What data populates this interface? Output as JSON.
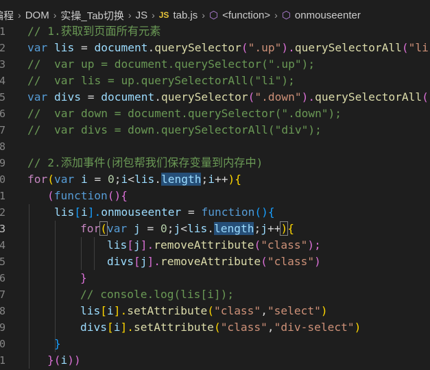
{
  "breadcrumb": {
    "items": [
      "编程",
      "DOM",
      "实操_Tab切换",
      "JS"
    ],
    "file_badge": "JS",
    "file": "tab.js",
    "scope1": "<function>",
    "scope2": "onmouseenter",
    "separator": "›"
  },
  "line_numbers": [
    "1",
    "2",
    "3",
    "4",
    "5",
    "6",
    "7",
    "8",
    "9",
    "0",
    "1",
    "2",
    "3",
    "4",
    "5",
    "6",
    "7",
    "8",
    "9",
    "0",
    "1"
  ],
  "active_line_index": 12,
  "code": {
    "l1": [
      "// 1.获取到页面所有元素"
    ],
    "l2": [
      "var",
      " ",
      "lis",
      " = ",
      "document",
      ".",
      "querySelector",
      "(",
      "\".up\"",
      ").",
      "querySelectorAll",
      "(",
      "\"li\""
    ],
    "l3": [
      "//  var up = document.querySelector(\".up\");"
    ],
    "l4": [
      "//  var lis = up.querySelectorAll(\"li\");"
    ],
    "l5": [
      "var",
      " ",
      "divs",
      " = ",
      "document",
      ".",
      "querySelector",
      "(",
      "\".down\"",
      ").",
      "querySelectorAll",
      "(",
      "\""
    ],
    "l6": [
      "//  var down = document.querySelector(\".down\");"
    ],
    "l7": [
      "//  var divs = down.querySelectorAll(\"div\");"
    ],
    "l9": [
      "// 2.添加事件(闭包帮我们保存变量到内存中)"
    ],
    "l10": [
      "for",
      "(",
      "var",
      " ",
      "i",
      " = ",
      "0",
      ";",
      "i",
      "<",
      "lis",
      ".",
      "length",
      ";",
      "i",
      "++",
      ")",
      "{"
    ],
    "l11": [
      "(",
      "function",
      "(){"
    ],
    "l12": [
      "lis",
      "[",
      "i",
      "].",
      "onmouseenter",
      " = ",
      "function",
      "()",
      "{"
    ],
    "l13": [
      "for",
      "(",
      "var",
      " ",
      "j",
      " = ",
      "0",
      ";",
      "j",
      "<",
      "lis",
      ".",
      "length",
      ";",
      "j",
      "++",
      ")",
      "{"
    ],
    "l14": [
      "lis",
      "[",
      "j",
      "].",
      "removeAttribute",
      "(",
      "\"class\"",
      ");"
    ],
    "l15": [
      "divs",
      "[",
      "j",
      "].",
      "removeAttribute",
      "(",
      "\"class\"",
      ")"
    ],
    "l16": [
      "}"
    ],
    "l17": [
      "// console.log(lis[i]);"
    ],
    "l18": [
      "lis",
      "[",
      "i",
      "].",
      "setAttribute",
      "(",
      "\"class\"",
      ",",
      "\"select\"",
      ")"
    ],
    "l19": [
      "divs",
      "[",
      "i",
      "].",
      "setAttribute",
      "(",
      "\"class\"",
      ",",
      "\"div-select\"",
      ")"
    ],
    "l20": [
      "}"
    ],
    "l21": [
      "}",
      "(",
      "i",
      "))"
    ]
  },
  "colors": {
    "background": "#1e1e1e",
    "comment": "#6a9955",
    "keyword": "#569cd6",
    "control": "#c586c0",
    "variable": "#9cdcfe",
    "function": "#dcdcaa",
    "string": "#ce9178",
    "number": "#b5cea8"
  }
}
